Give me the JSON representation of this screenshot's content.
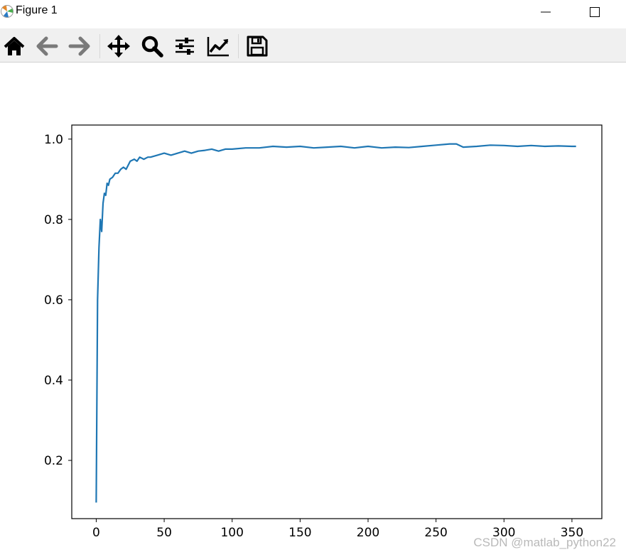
{
  "window": {
    "title": "Figure 1",
    "app_icon": "matplotlib-icon",
    "controls": [
      "minimize-icon",
      "maximize-icon"
    ]
  },
  "toolbar": {
    "buttons": [
      {
        "name": "home",
        "icon": "home-icon"
      },
      {
        "name": "back",
        "icon": "arrow-left-icon"
      },
      {
        "name": "forward",
        "icon": "arrow-right-icon"
      },
      {
        "name": "pan",
        "icon": "move-icon"
      },
      {
        "name": "zoom",
        "icon": "magnifier-icon"
      },
      {
        "name": "configure-subplots",
        "icon": "sliders-icon"
      },
      {
        "name": "edit-axis",
        "icon": "line-chart-icon"
      },
      {
        "name": "save",
        "icon": "floppy-disk-icon"
      }
    ]
  },
  "watermark": "CSDN @matlab_python22",
  "chart_data": {
    "type": "line",
    "title": "",
    "xlabel": "",
    "ylabel": "",
    "xlim": [
      -18,
      372
    ],
    "ylim": [
      0.055,
      1.035
    ],
    "xticks": [
      0,
      50,
      100,
      150,
      200,
      250,
      300,
      350
    ],
    "yticks": [
      0.2,
      0.4,
      0.6,
      0.8,
      1.0
    ],
    "ytick_labels": [
      "0.2",
      "0.4",
      "0.6",
      "0.8",
      "1.0"
    ],
    "grid": false,
    "line_color": "#1f77b4",
    "series": [
      {
        "x": [
          0,
          1,
          2,
          3,
          4,
          5,
          6,
          7,
          8,
          9,
          10,
          12,
          14,
          16,
          18,
          20,
          22,
          25,
          28,
          30,
          32,
          35,
          38,
          40,
          45,
          50,
          55,
          60,
          65,
          70,
          75,
          80,
          85,
          90,
          95,
          100,
          110,
          120,
          130,
          140,
          150,
          160,
          170,
          180,
          190,
          200,
          210,
          220,
          230,
          240,
          250,
          260,
          265,
          270,
          280,
          290,
          300,
          310,
          320,
          330,
          340,
          350,
          353
        ],
        "y": [
          0.095,
          0.6,
          0.73,
          0.8,
          0.77,
          0.84,
          0.865,
          0.86,
          0.89,
          0.885,
          0.9,
          0.905,
          0.915,
          0.915,
          0.925,
          0.93,
          0.925,
          0.945,
          0.95,
          0.945,
          0.955,
          0.95,
          0.955,
          0.955,
          0.96,
          0.965,
          0.96,
          0.965,
          0.97,
          0.965,
          0.97,
          0.972,
          0.975,
          0.97,
          0.975,
          0.975,
          0.978,
          0.978,
          0.982,
          0.98,
          0.982,
          0.978,
          0.98,
          0.982,
          0.978,
          0.982,
          0.978,
          0.98,
          0.979,
          0.982,
          0.985,
          0.988,
          0.988,
          0.98,
          0.982,
          0.985,
          0.984,
          0.982,
          0.984,
          0.982,
          0.983,
          0.982,
          0.982
        ]
      }
    ]
  }
}
